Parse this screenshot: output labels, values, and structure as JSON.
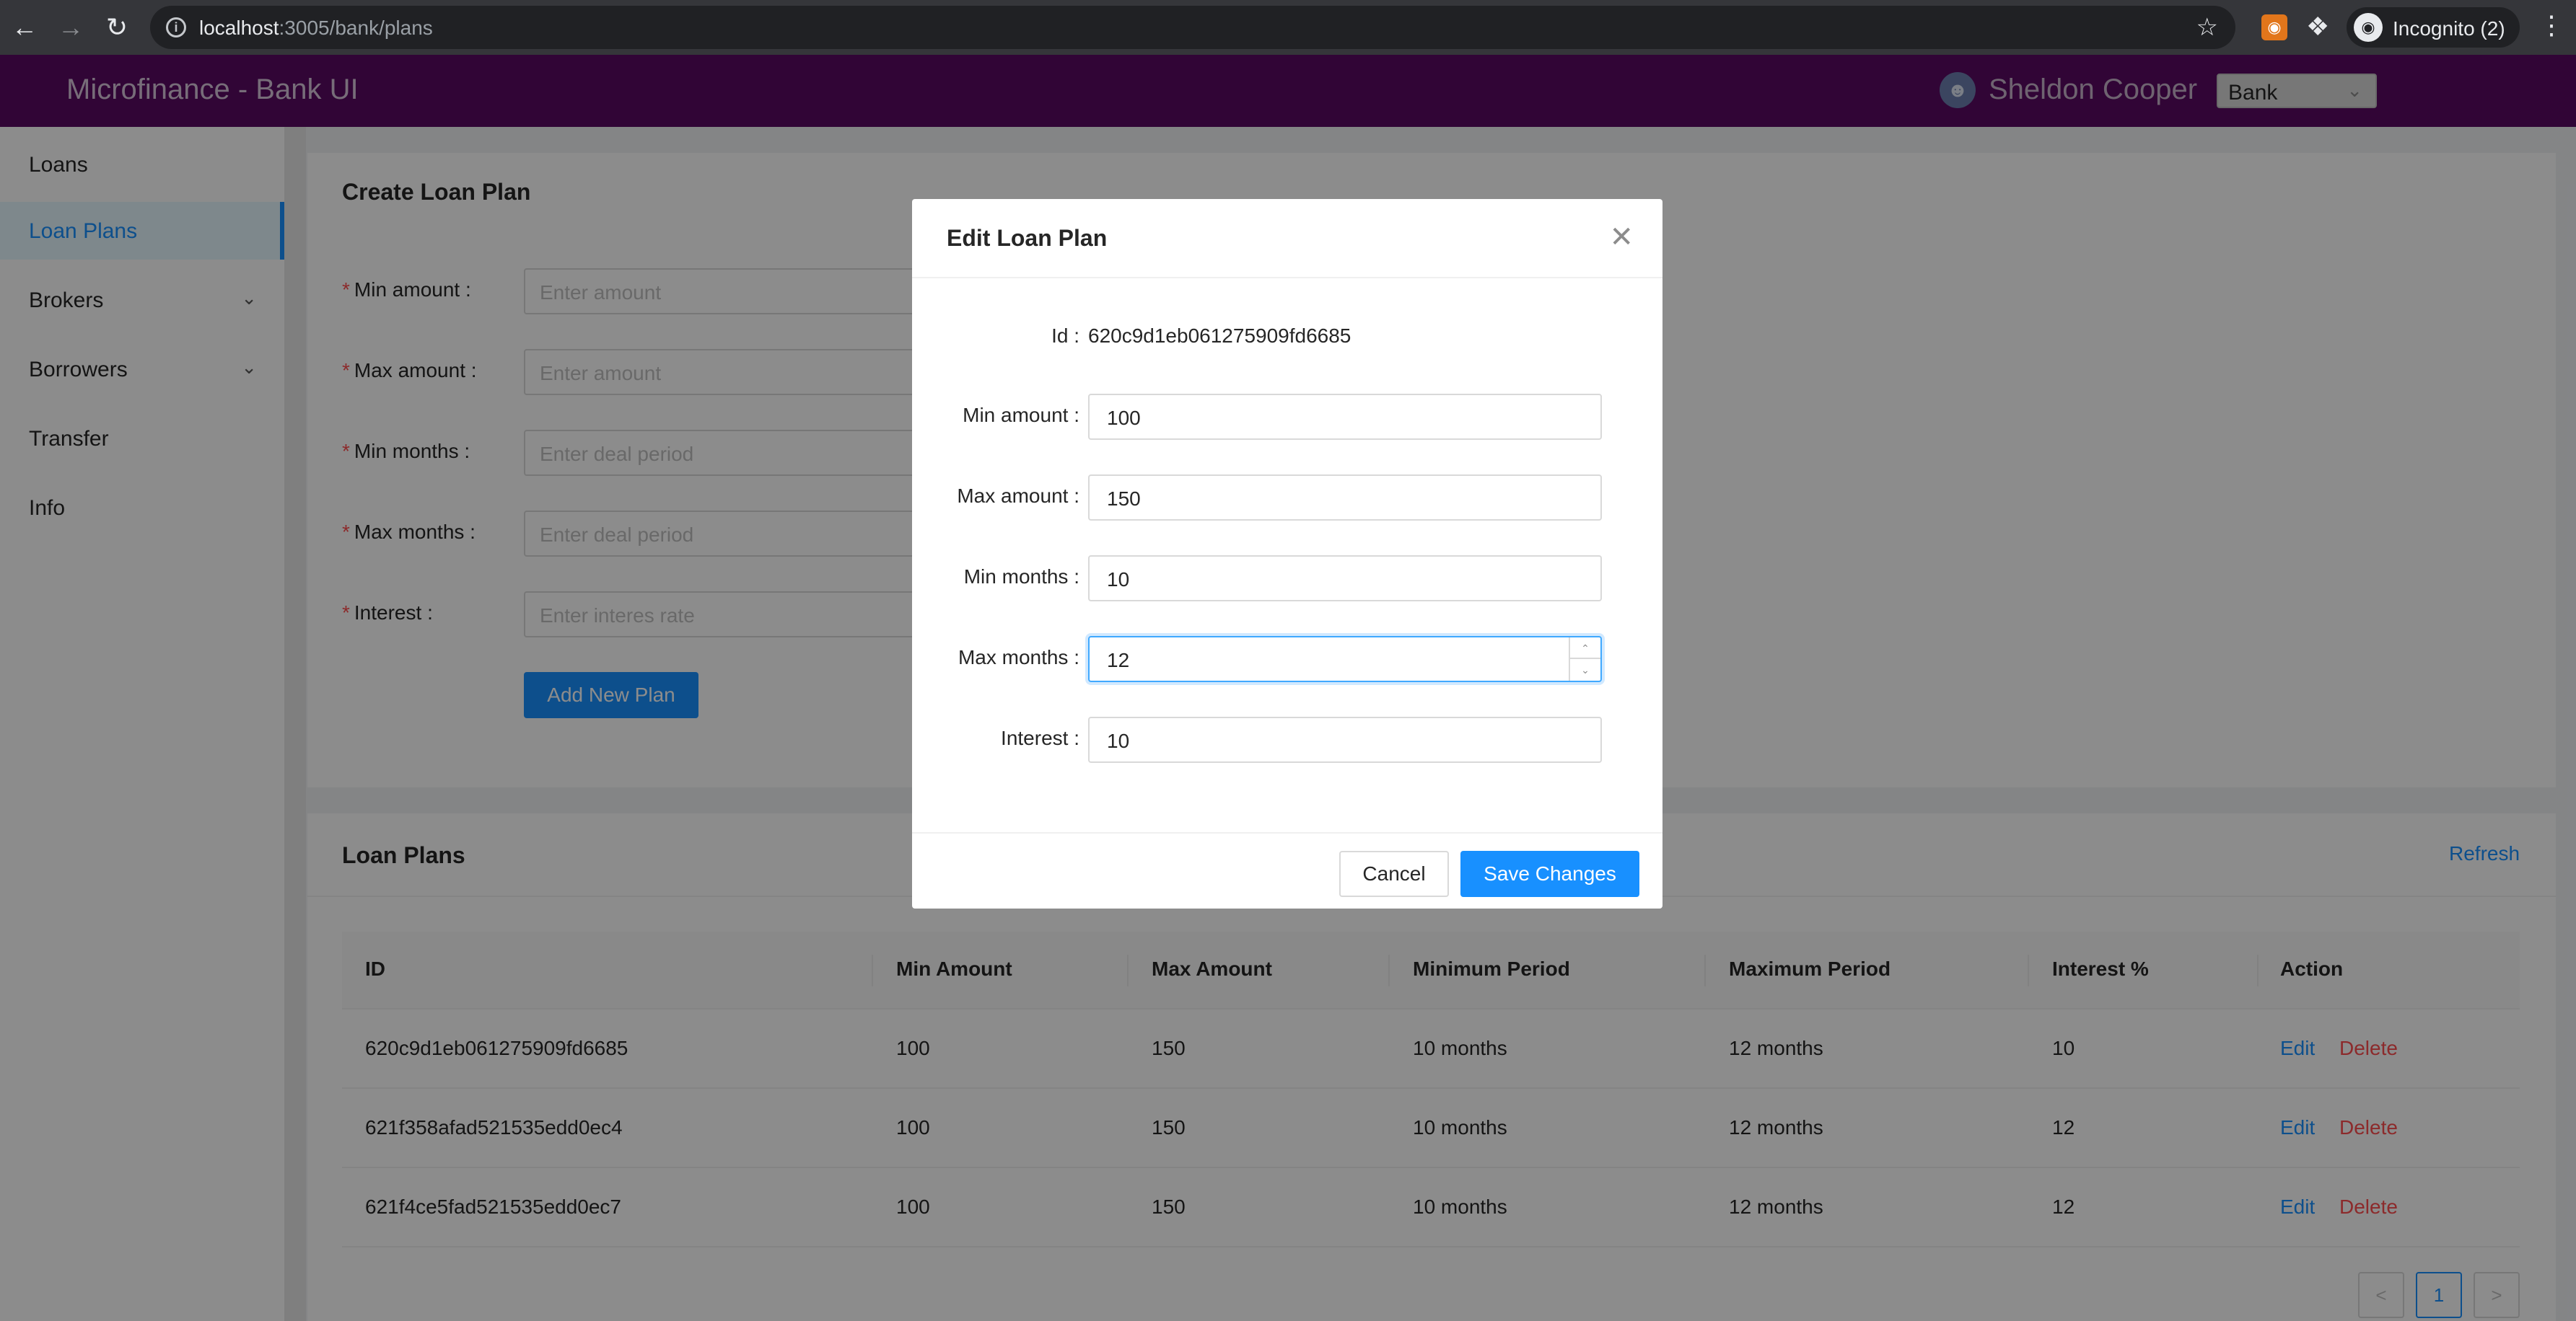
{
  "browser": {
    "url_host": "localhost",
    "url_path": ":3005/bank/plans",
    "incognito_label": "Incognito (2)"
  },
  "header": {
    "app_title": "Microfinance - Bank UI",
    "user_name": "Sheldon Cooper",
    "role_select": "Bank"
  },
  "sidebar": {
    "items": [
      {
        "label": "Loans"
      },
      {
        "label": "Loan Plans"
      },
      {
        "label": "Brokers"
      },
      {
        "label": "Borrowers"
      },
      {
        "label": "Transfer"
      },
      {
        "label": "Info"
      }
    ]
  },
  "create_form": {
    "title": "Create Loan Plan",
    "fields": [
      {
        "label": "Min amount",
        "placeholder": "Enter amount"
      },
      {
        "label": "Max amount",
        "placeholder": "Enter amount"
      },
      {
        "label": "Min months",
        "placeholder": "Enter deal period"
      },
      {
        "label": "Max months",
        "placeholder": "Enter deal period"
      },
      {
        "label": "Interest",
        "placeholder": "Enter interes rate"
      }
    ],
    "submit_label": "Add New Plan"
  },
  "plans_table": {
    "title": "Loan Plans",
    "refresh_label": "Refresh",
    "columns": [
      "ID",
      "Min Amount",
      "Max Amount",
      "Minimum Period",
      "Maximum Period",
      "Interest %",
      "Action"
    ],
    "rows": [
      {
        "id": "620c9d1eb061275909fd6685",
        "min": "100",
        "max": "150",
        "min_period": "10 months",
        "max_period": "12 months",
        "interest": "10",
        "edit": "Edit",
        "delete": "Delete"
      },
      {
        "id": "621f358afad521535edd0ec4",
        "min": "100",
        "max": "150",
        "min_period": "10 months",
        "max_period": "12 months",
        "interest": "12",
        "edit": "Edit",
        "delete": "Delete"
      },
      {
        "id": "621f4ce5fad521535edd0ec7",
        "min": "100",
        "max": "150",
        "min_period": "10 months",
        "max_period": "12 months",
        "interest": "12",
        "edit": "Edit",
        "delete": "Delete"
      }
    ],
    "pagination": {
      "prev": "<",
      "current": "1",
      "next": ">"
    }
  },
  "modal": {
    "title": "Edit Loan Plan",
    "id_label": "Id",
    "id_value": "620c9d1eb061275909fd6685",
    "fields": [
      {
        "label": "Min amount",
        "value": "100"
      },
      {
        "label": "Max amount",
        "value": "150"
      },
      {
        "label": "Min months",
        "value": "10"
      },
      {
        "label": "Max months",
        "value": "12"
      },
      {
        "label": "Interest",
        "value": "10"
      }
    ],
    "cancel_label": "Cancel",
    "save_label": "Save Changes"
  },
  "colors": {
    "header_bg": "#5a0a63",
    "primary": "#1890ff",
    "danger": "#ff4d4f"
  },
  "icons": [
    "back-arrow-icon",
    "forward-arrow-icon",
    "reload-icon",
    "info-icon",
    "star-icon",
    "metamask-icon",
    "puzzle-icon",
    "incognito-icon",
    "menu-dots-icon",
    "user-icon",
    "chevron-down-icon",
    "close-icon",
    "stepper-up-icon",
    "stepper-down-icon"
  ]
}
